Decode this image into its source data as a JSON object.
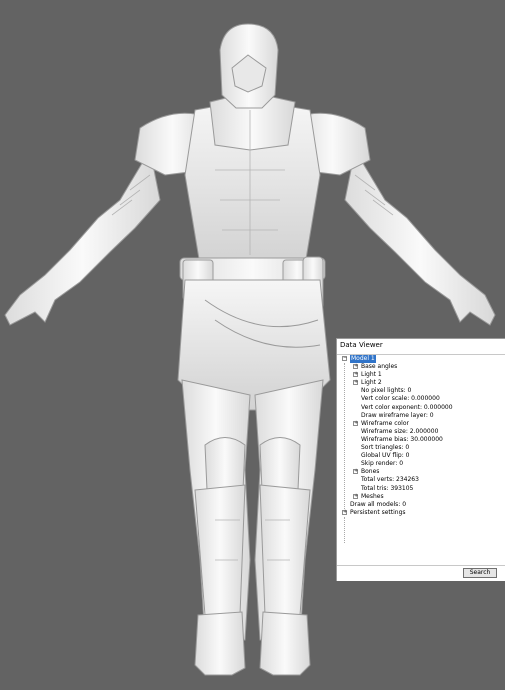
{
  "colors": {
    "background": "#636363",
    "model": "#f0f0f0",
    "selection": "#3074c9"
  },
  "panel": {
    "title": "Data Viewer",
    "tree": [
      {
        "label": "Model 1",
        "level": 0,
        "expander": "minus",
        "selected": true
      },
      {
        "label": "Base angles",
        "level": 1,
        "expander": "plus"
      },
      {
        "label": "Light 1",
        "level": 1,
        "expander": "plus"
      },
      {
        "label": "Light 2",
        "level": 1,
        "expander": "plus"
      },
      {
        "label": "No pixel lights: 0",
        "level": 1,
        "expander": "none"
      },
      {
        "label": "Vert color scale: 0.000000",
        "level": 1,
        "expander": "none"
      },
      {
        "label": "Vert color exponent: 0.000000",
        "level": 1,
        "expander": "none"
      },
      {
        "label": "Draw wireframe layer: 0",
        "level": 1,
        "expander": "none"
      },
      {
        "label": "Wireframe color",
        "level": 1,
        "expander": "plus"
      },
      {
        "label": "Wireframe size: 2.000000",
        "level": 1,
        "expander": "none"
      },
      {
        "label": "Wireframe bias: 30.000000",
        "level": 1,
        "expander": "none"
      },
      {
        "label": "Sort triangles: 0",
        "level": 1,
        "expander": "none"
      },
      {
        "label": "Global UV flip: 0",
        "level": 1,
        "expander": "none"
      },
      {
        "label": "Skip render: 0",
        "level": 1,
        "expander": "none"
      },
      {
        "label": "Bones",
        "level": 1,
        "expander": "plus"
      },
      {
        "label": "Total verts: 234263",
        "level": 1,
        "expander": "none"
      },
      {
        "label": "Total tris: 393105",
        "level": 1,
        "expander": "none"
      },
      {
        "label": "Meshes",
        "level": 1,
        "expander": "plus"
      },
      {
        "label": "Draw all models: 0",
        "level": 0,
        "expander": "none"
      },
      {
        "label": "Persistent settings",
        "level": 0,
        "expander": "plus"
      }
    ],
    "search_label": "Search"
  }
}
